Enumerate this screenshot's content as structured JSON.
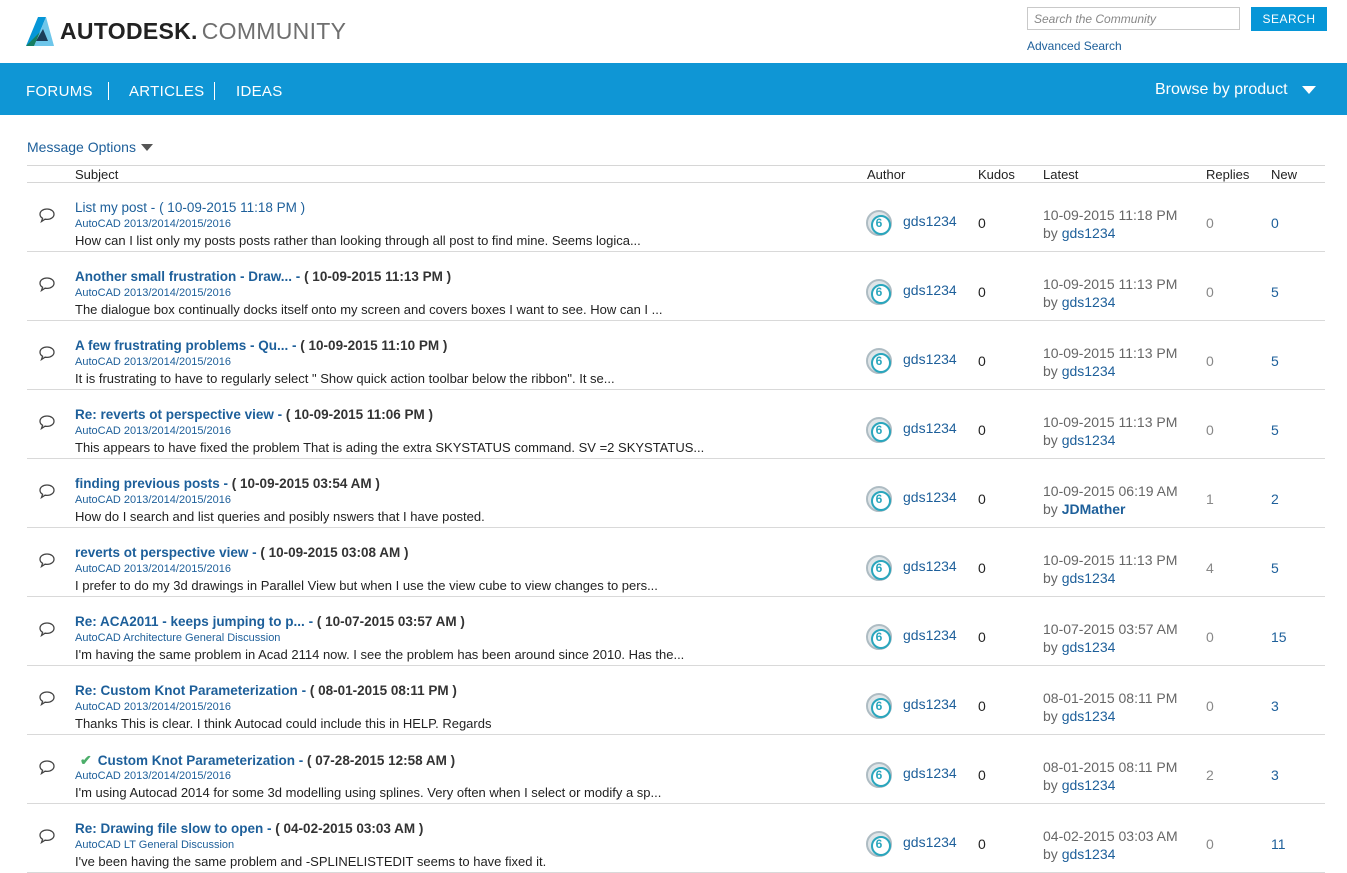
{
  "header": {
    "brand": "AUTODESK.",
    "brand_sub": "COMMUNITY",
    "search_placeholder": "Search the Community",
    "search_button": "SEARCH",
    "advanced_search": "Advanced Search"
  },
  "nav": {
    "items": [
      "FORUMS",
      "ARTICLES",
      "IDEAS"
    ],
    "browse": "Browse by product"
  },
  "message_options": "Message Options",
  "columns": {
    "subject": "Subject",
    "author": "Author",
    "kudos": "Kudos",
    "latest": "Latest",
    "replies": "Replies",
    "new": "New"
  },
  "rows": [
    {
      "title": "List my post",
      "date": "( 10-09-2015 11:18 PM )",
      "board": "AutoCAD 2013/2014/2015/2016",
      "teaser": "How can I list only my posts posts rather than looking through all post to find mine. Seems logica...",
      "author": "gds1234",
      "kudos": "0",
      "latest_date": "10-09-2015 11:18 PM",
      "latest_by": "gds1234",
      "replies": "0",
      "new": "0"
    },
    {
      "title": "Another small frustration - Draw...",
      "date": "( 10-09-2015 11:13 PM )",
      "board": "AutoCAD 2013/2014/2015/2016",
      "teaser": "The dialogue box continually docks itself onto my screen and covers boxes I want to see. How can I ...",
      "author": "gds1234",
      "kudos": "0",
      "latest_date": "10-09-2015 11:13 PM",
      "latest_by": "gds1234",
      "replies": "0",
      "new": "5"
    },
    {
      "title": "A few frustrating problems - Qu...",
      "date": "( 10-09-2015 11:10 PM )",
      "board": "AutoCAD 2013/2014/2015/2016",
      "teaser": "It is frustrating to have to regularly select \" Show quick action toolbar below the ribbon\". It se...",
      "author": "gds1234",
      "kudos": "0",
      "latest_date": "10-09-2015 11:13 PM",
      "latest_by": "gds1234",
      "replies": "0",
      "new": "5"
    },
    {
      "title": "Re: reverts ot perspective view",
      "date": "( 10-09-2015 11:06 PM )",
      "board": "AutoCAD 2013/2014/2015/2016",
      "teaser": "This appears to have fixed the problem That is ading the extra SKYSTATUS command. SV =2 SKYSTATUS...",
      "author": "gds1234",
      "kudos": "0",
      "latest_date": "10-09-2015 11:13 PM",
      "latest_by": "gds1234",
      "replies": "0",
      "new": "5"
    },
    {
      "title": "finding previous posts",
      "date": "( 10-09-2015 03:54 AM )",
      "board": "AutoCAD 2013/2014/2015/2016",
      "teaser": "How do I search and list queries and posibly nswers that I have posted.",
      "author": "gds1234",
      "kudos": "0",
      "latest_date": "10-09-2015 06:19 AM",
      "latest_by": "JDMather",
      "replies": "1",
      "new": "2"
    },
    {
      "title": "reverts ot perspective view",
      "date": "( 10-09-2015 03:08 AM )",
      "board": "AutoCAD 2013/2014/2015/2016",
      "teaser": "I prefer to do my 3d drawings in Parallel View but when I use the view cube to view changes to pers...",
      "author": "gds1234",
      "kudos": "0",
      "latest_date": "10-09-2015 11:13 PM",
      "latest_by": "gds1234",
      "replies": "4",
      "new": "5"
    },
    {
      "title": "Re: ACA2011 - keeps jumping to p...",
      "date": "( 10-07-2015 03:57 AM )",
      "board": "AutoCAD Architecture General Discussion",
      "teaser": "I'm having the same problem in Acad 2114 now. I see the problem has been around since 2010. Has the...",
      "author": "gds1234",
      "kudos": "0",
      "latest_date": "10-07-2015 03:57 AM",
      "latest_by": "gds1234",
      "replies": "0",
      "new": "15"
    },
    {
      "title": "Re: Custom Knot Parameterization",
      "date": "( 08-01-2015 08:11 PM )",
      "board": "AutoCAD 2013/2014/2015/2016",
      "teaser": "Thanks This is clear. I think Autocad could include this in HELP. Regards",
      "author": "gds1234",
      "kudos": "0",
      "latest_date": "08-01-2015 08:11 PM",
      "latest_by": "gds1234",
      "replies": "0",
      "new": "3"
    },
    {
      "title": "Custom Knot Parameterization",
      "date": "( 07-28-2015 12:58 AM )",
      "board": "AutoCAD 2013/2014/2015/2016",
      "teaser": "I'm using Autocad 2014 for some 3d modelling using splines. Very often when I select or modify a sp...",
      "author": "gds1234",
      "kudos": "0",
      "latest_date": "08-01-2015 08:11 PM",
      "latest_by": "gds1234",
      "replies": "2",
      "new": "3"
    },
    {
      "title": "Re: Drawing file slow to open",
      "date": "( 04-02-2015 03:03 AM )",
      "board": "AutoCAD LT General Discussion",
      "teaser": "I've been having the same problem and -SPLINELISTEDIT seems to have fixed it.",
      "author": "gds1234",
      "kudos": "0",
      "latest_date": "04-02-2015 03:03 AM",
      "latest_by": "gds1234",
      "replies": "0",
      "new": "11"
    }
  ],
  "avatar_glyph": "6",
  "latest_by_prefix": "by",
  "subject_separator": "-"
}
